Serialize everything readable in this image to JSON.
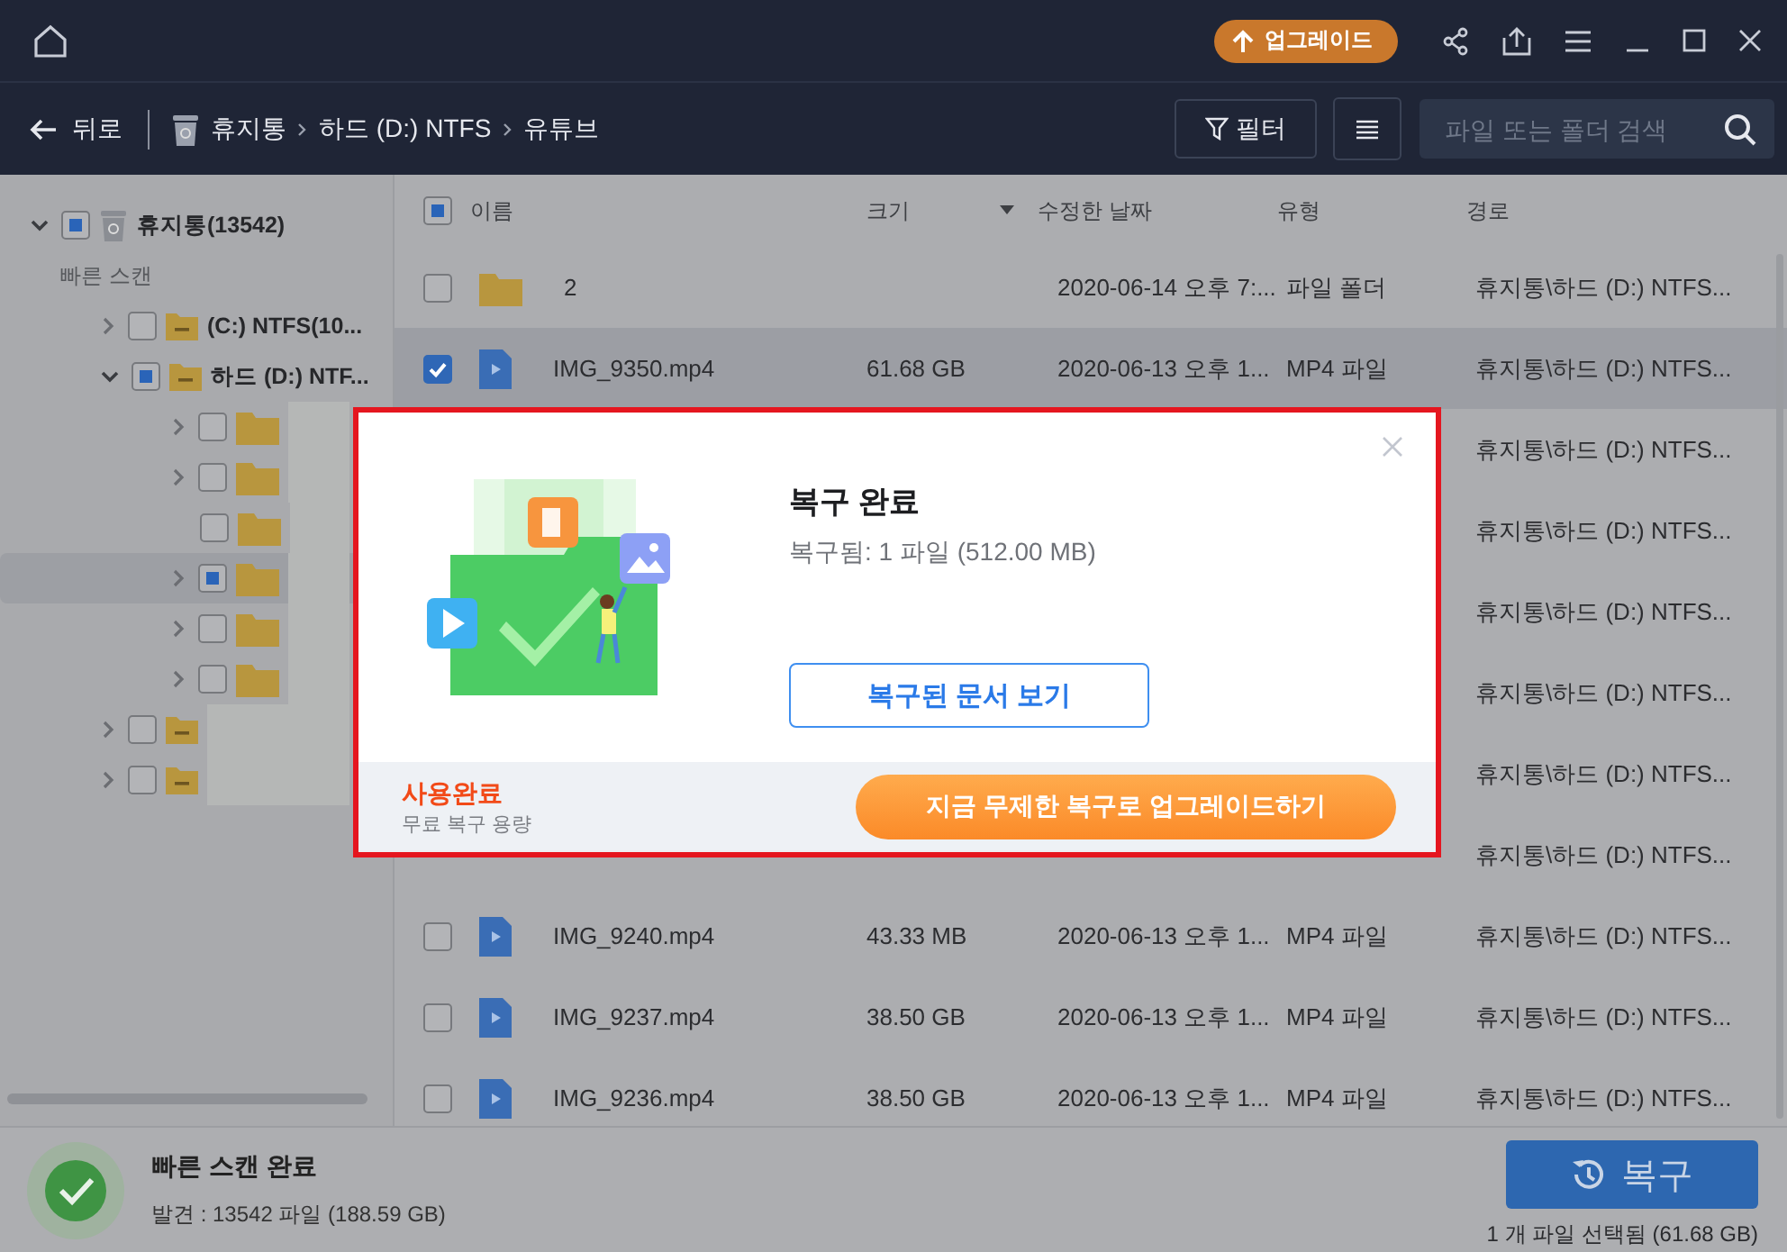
{
  "title_bar": {
    "upgrade_button": "업그레이드"
  },
  "nav": {
    "back": "뒤로",
    "breadcrumb": [
      {
        "label": "휴지통",
        "kind": "trash"
      },
      {
        "label": "하드 (D:) NTFS",
        "kind": "plain"
      },
      {
        "label": "유튜브",
        "kind": "plain"
      }
    ],
    "filter_button": "필터",
    "search": {
      "placeholder": "파일 또는 폴더 검색"
    }
  },
  "tree": [
    {
      "label": "휴지통(13542)",
      "kind": "trash",
      "checked": false,
      "partial": true,
      "expanded": true,
      "expandable": true,
      "selected": false,
      "section_label": "빠른 스캔",
      "children": [
        {
          "label": "(C:) NTFS(10...",
          "kind": "drive",
          "checked": false,
          "partial": false,
          "expanded": false,
          "expandable": true,
          "selected": false
        },
        {
          "label": "하드 (D:) NTF...",
          "kind": "drive",
          "checked": false,
          "partial": true,
          "expanded": true,
          "expandable": true,
          "selected": false,
          "children": [
            {
              "kind": "folder",
              "blurred": true,
              "checked": false,
              "partial": false,
              "expanded": false,
              "expandable": true,
              "selected": false
            },
            {
              "kind": "folder",
              "blurred": true,
              "checked": false,
              "partial": false,
              "expanded": false,
              "expandable": true,
              "selected": false
            },
            {
              "kind": "folder",
              "blurred": true,
              "checked": false,
              "partial": false,
              "expandable": false,
              "selected": false
            },
            {
              "kind": "folder",
              "blurred": true,
              "checked": false,
              "partial": true,
              "expanded": false,
              "expandable": true,
              "selected": true
            },
            {
              "kind": "folder",
              "blurred": true,
              "checked": false,
              "partial": false,
              "expanded": false,
              "expandable": true,
              "selected": false
            },
            {
              "kind": "folder",
              "blurred": true,
              "checked": false,
              "partial": false,
              "expanded": false,
              "expandable": true,
              "selected": false
            }
          ]
        },
        {
          "kind": "drive",
          "blurred": true,
          "checked": false,
          "partial": false,
          "expanded": false,
          "expandable": true,
          "selected": false
        },
        {
          "kind": "drive",
          "blurred": true,
          "checked": false,
          "partial": false,
          "expanded": false,
          "expandable": true,
          "selected": false
        }
      ]
    }
  ],
  "table": {
    "header_checked": false,
    "header_partial": true,
    "columns": [
      {
        "label": "이름",
        "sorted": false
      },
      {
        "label": "크기",
        "sorted": false
      },
      {
        "label": "수정한 날짜",
        "sorted": true
      },
      {
        "label": "유형",
        "sorted": false
      },
      {
        "label": "경로",
        "sorted": false
      }
    ],
    "rows": [
      {
        "kind": "folder",
        "checked": false,
        "selected": false,
        "name": "2",
        "modified": "2020-06-14 오후 7:...",
        "type": "파일 폴더",
        "path": "휴지통\\하드 (D:) NTFS..."
      },
      {
        "kind": "video",
        "checked": true,
        "selected": true,
        "name": "IMG_9350.mp4",
        "size": "61.68 GB",
        "modified": "2020-06-13 오후 1...",
        "type": "MP4 파일",
        "path": "휴지통\\하드 (D:) NTFS..."
      },
      {
        "kind": "covered",
        "path": "휴지통\\하드 (D:) NTFS..."
      },
      {
        "kind": "covered",
        "path": "휴지통\\하드 (D:) NTFS..."
      },
      {
        "kind": "covered",
        "path": "휴지통\\하드 (D:) NTFS..."
      },
      {
        "kind": "covered",
        "path": "휴지통\\하드 (D:) NTFS..."
      },
      {
        "kind": "covered",
        "path": "휴지통\\하드 (D:) NTFS..."
      },
      {
        "kind": "covered",
        "path": "휴지통\\하드 (D:) NTFS..."
      },
      {
        "kind": "video",
        "checked": false,
        "selected": false,
        "name": "IMG_9240.mp4",
        "size": "43.33 MB",
        "modified": "2020-06-13 오후 1...",
        "type": "MP4 파일",
        "path": "휴지통\\하드 (D:) NTFS..."
      },
      {
        "kind": "video",
        "checked": false,
        "selected": false,
        "name": "IMG_9237.mp4",
        "size": "38.50 GB",
        "modified": "2020-06-13 오후 1...",
        "type": "MP4 파일",
        "path": "휴지통\\하드 (D:) NTFS..."
      },
      {
        "kind": "video",
        "checked": false,
        "selected": false,
        "name": "IMG_9236.mp4",
        "size": "38.50 GB",
        "modified": "2020-06-13 오후 1...",
        "type": "MP4 파일",
        "path": "휴지통\\하드 (D:) NTFS..."
      }
    ]
  },
  "dialog": {
    "title": "복구 완료",
    "summary": "복구됨: 1 파일 (512.00 MB)",
    "view_button": "복구된 문서 보기",
    "quota_title": "사용완료",
    "quota_note": "무료 복구 용량",
    "upgrade_button": "지금 무제한 복구로 업그레이드하기"
  },
  "status_bar": {
    "title": "빠른 스캔 완료",
    "found": "발견 : 13542 파일 (188.59 GB)",
    "recover_button": "복구",
    "selection": "1 개 파일 선택됨 (61.68 GB)"
  }
}
